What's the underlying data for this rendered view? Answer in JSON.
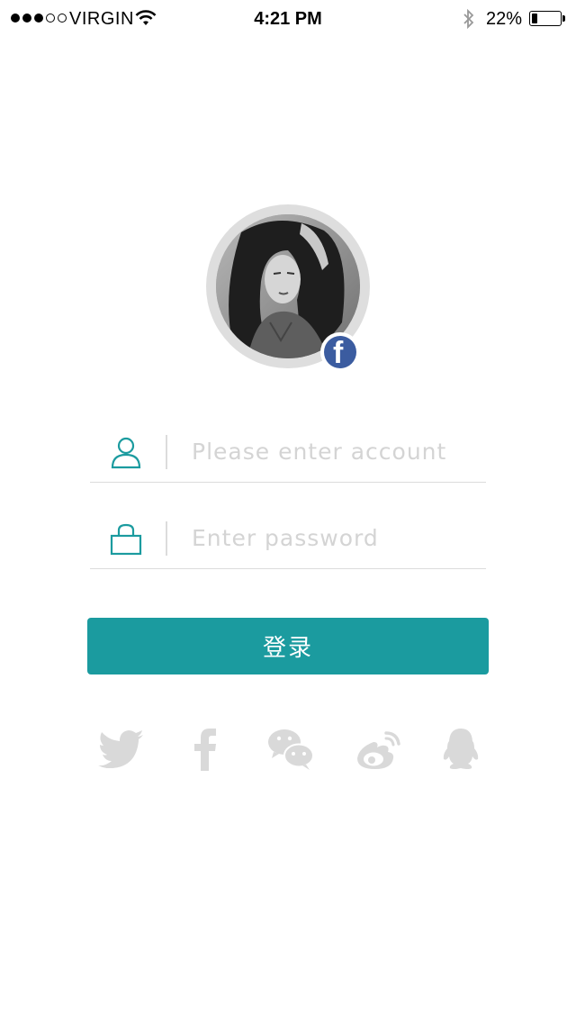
{
  "status_bar": {
    "carrier": "VIRGIN",
    "time": "4:21 PM",
    "battery_pct": "22%",
    "battery_level": 0.22,
    "signal_bars_filled": 3,
    "signal_bars_total": 5
  },
  "avatar": {
    "badge_icon": "facebook-icon"
  },
  "form": {
    "account_placeholder": "Please enter account",
    "account_icon": "user-icon",
    "password_placeholder": "Enter password",
    "password_icon": "lock-icon",
    "login_label": "登录"
  },
  "social": [
    "twitter-icon",
    "facebook-icon",
    "wechat-icon",
    "weibo-icon",
    "qq-icon"
  ],
  "colors": {
    "accent": "#1b9b9f",
    "social_icon": "#d9d9d9",
    "facebook_blue": "#3b5ca0"
  }
}
